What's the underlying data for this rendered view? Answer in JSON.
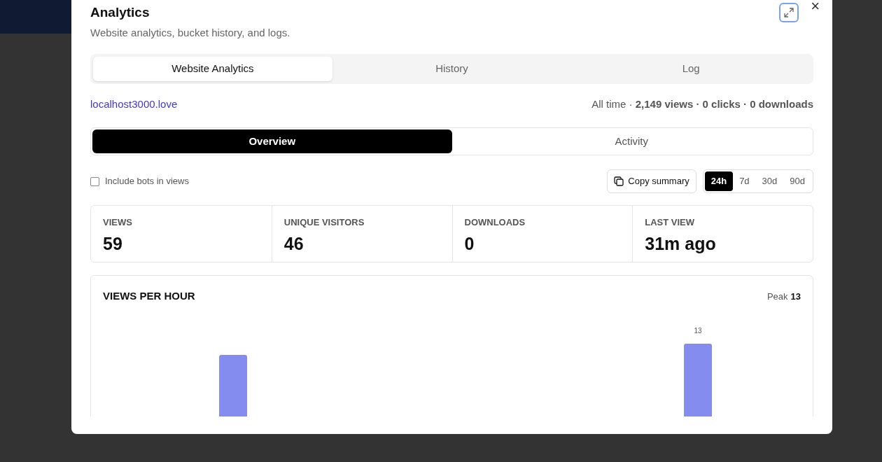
{
  "dialog": {
    "title": "Analytics",
    "subtitle": "Website analytics, bucket history, and logs.",
    "close": "×"
  },
  "tabs": [
    {
      "label": "Website Analytics",
      "selected": true
    },
    {
      "label": "History",
      "selected": false
    },
    {
      "label": "Log",
      "selected": false
    }
  ],
  "site": {
    "link": "localhost3000.love",
    "summary": "All time · **2,149 views · 0 clicks · 0 downloads**"
  },
  "subtabs": [
    {
      "label": "Overview",
      "selected": true
    },
    {
      "label": "Activity",
      "selected": false
    }
  ],
  "include_bots": {
    "label": "Include bots in views",
    "checked": false
  },
  "copy_button": "Copy summary",
  "ranges": [
    {
      "label": "24h",
      "selected": true
    },
    {
      "label": "7d",
      "selected": false
    },
    {
      "label": "30d",
      "selected": false
    },
    {
      "label": "90d",
      "selected": false
    }
  ],
  "stats": [
    {
      "label": "VIEWS",
      "value": "59"
    },
    {
      "label": "UNIQUE VISITORS",
      "value": "46"
    },
    {
      "label": "DOWNLOADS",
      "value": "0"
    },
    {
      "label": "LAST VIEW",
      "value": "31m ago"
    }
  ],
  "chart": {
    "title": "VIEWS PER HOUR",
    "peak_label": "Peak",
    "peak_value": "13",
    "bar_label": "13"
  }
}
